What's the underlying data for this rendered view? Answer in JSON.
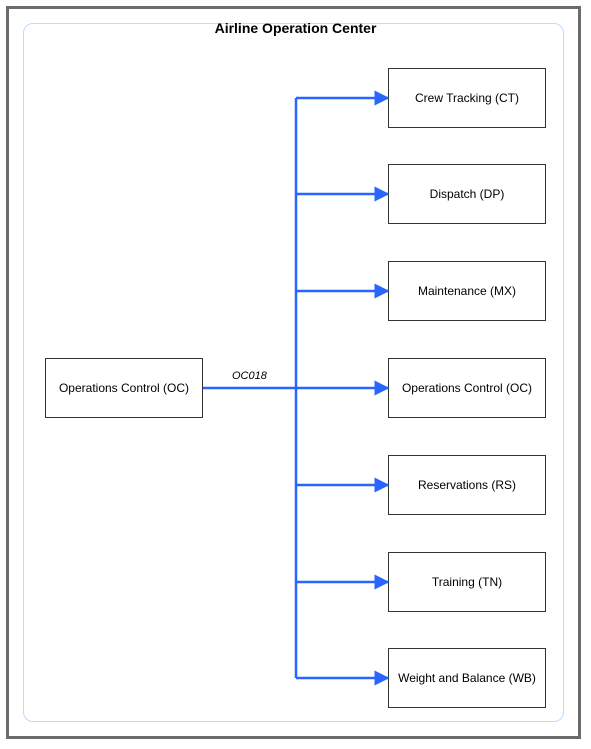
{
  "diagram": {
    "title": "Airline Operation Center",
    "source": {
      "label": "Operations Control (OC)"
    },
    "edge_label": "OC018",
    "targets": [
      {
        "label": "Crew Tracking (CT)"
      },
      {
        "label": "Dispatch (DP)"
      },
      {
        "label": "Maintenance (MX)"
      },
      {
        "label": "Operations Control (OC)"
      },
      {
        "label": "Reservations (RS)"
      },
      {
        "label": "Training (TN)"
      },
      {
        "label": "Weight and Balance (WB)"
      }
    ]
  },
  "chart_data": {
    "type": "diagram",
    "title": "Airline Operation Center",
    "nodes": [
      {
        "id": "OC_src",
        "label": "Operations Control (OC)"
      },
      {
        "id": "CT",
        "label": "Crew Tracking (CT)"
      },
      {
        "id": "DP",
        "label": "Dispatch (DP)"
      },
      {
        "id": "MX",
        "label": "Maintenance (MX)"
      },
      {
        "id": "OC_tgt",
        "label": "Operations Control (OC)"
      },
      {
        "id": "RS",
        "label": "Reservations (RS)"
      },
      {
        "id": "TN",
        "label": "Training (TN)"
      },
      {
        "id": "WB",
        "label": "Weight and Balance (WB)"
      }
    ],
    "edges": [
      {
        "from": "OC_src",
        "to": "CT",
        "label": "OC018"
      },
      {
        "from": "OC_src",
        "to": "DP",
        "label": "OC018"
      },
      {
        "from": "OC_src",
        "to": "MX",
        "label": "OC018"
      },
      {
        "from": "OC_src",
        "to": "OC_tgt",
        "label": "OC018"
      },
      {
        "from": "OC_src",
        "to": "RS",
        "label": "OC018"
      },
      {
        "from": "OC_src",
        "to": "TN",
        "label": "OC018"
      },
      {
        "from": "OC_src",
        "to": "WB",
        "label": "OC018"
      }
    ]
  }
}
